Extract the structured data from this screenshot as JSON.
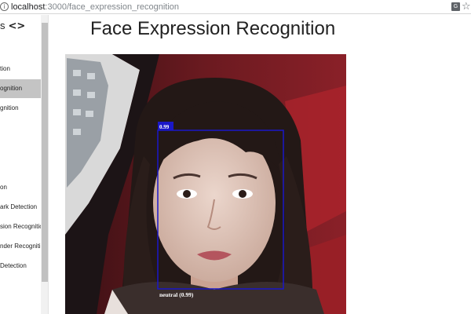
{
  "browser": {
    "url_host": "localhost",
    "url_path": ":3000/face_expression_recognition"
  },
  "sidebar": {
    "header_label": "s",
    "toggle_label": "<>",
    "items": [
      {
        "label": "tion",
        "align": "left"
      },
      {
        "label": "ognition",
        "align": "left",
        "active": true
      },
      {
        "label": "gnition",
        "align": "left"
      },
      {
        "label": "on",
        "align": "left"
      },
      {
        "label": "ark Detection",
        "align": "left"
      },
      {
        "label": "sion Recognition",
        "align": "left"
      },
      {
        "label": "nder Recognition",
        "align": "left"
      },
      {
        "label": "Detection",
        "align": "left"
      }
    ]
  },
  "main": {
    "title": "Face Expression Recognition"
  },
  "detection": {
    "score": "0.99",
    "expression_label": "neutral (0.99)",
    "box_color": "#1a17c8"
  }
}
